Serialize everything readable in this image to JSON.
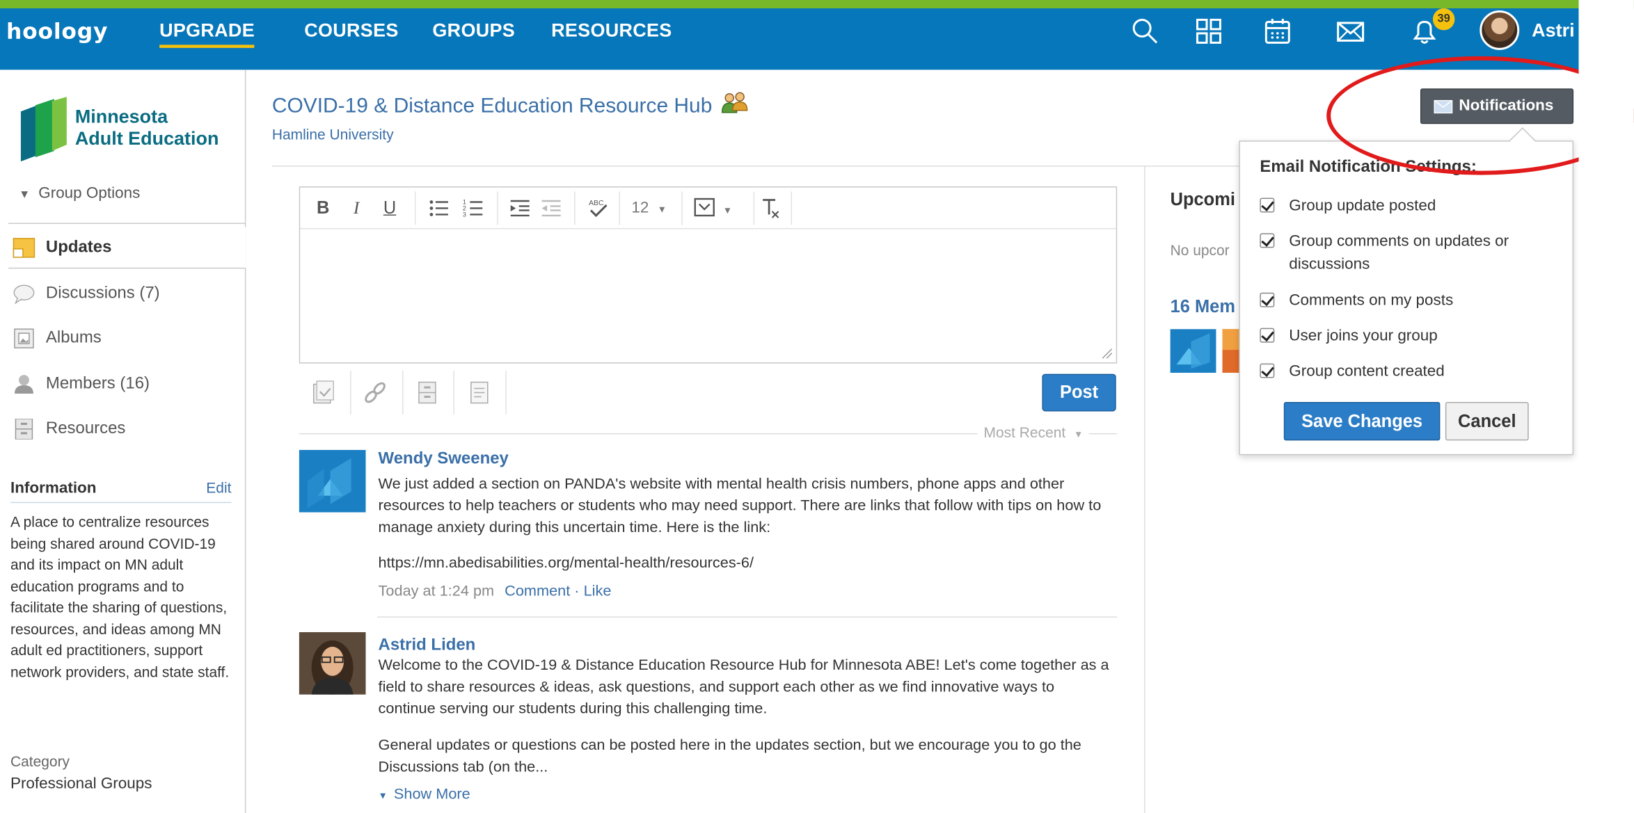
{
  "nav": {
    "logo": "hoology",
    "links": [
      "UPGRADE",
      "COURSES",
      "GROUPS",
      "RESOURCES"
    ],
    "notification_count": "39",
    "user_name": "Astri"
  },
  "sidebar": {
    "org_name_line1": "Minnesota",
    "org_name_line2": "Adult Education",
    "group_options": "Group Options",
    "items": [
      {
        "label": "Updates"
      },
      {
        "label": "Discussions (7)"
      },
      {
        "label": "Albums"
      },
      {
        "label": "Members (16)"
      },
      {
        "label": "Resources"
      }
    ],
    "info_heading": "Information",
    "info_edit": "Edit",
    "info_text": "A place to centralize resources being shared around COVID-19 and its impact on MN adult education programs and to facilitate the sharing of questions, resources, and ideas among MN adult ed practitioners, support network providers, and state staff.",
    "category_label": "Category",
    "category_value": "Professional Groups"
  },
  "main": {
    "title": "COVID-19 & Distance Education Resource Hub",
    "subtitle": "Hamline University",
    "toolbar": {
      "bold": "B",
      "italic": "I",
      "underline": "U",
      "font_size": "12"
    },
    "post_button": "Post",
    "sort_label": "Most Recent",
    "posts": [
      {
        "author": "Wendy Sweeney",
        "text": "We just added a section on PANDA's website with mental health crisis numbers, phone apps and other resources to help teachers or students who may need support.  There are links that follow with tips on how to manage anxiety during this uncertain time.  Here is the link:",
        "link": "https://mn.abedisabilities.org/mental-health/resources-6/",
        "time": "Today at 1:24 pm",
        "actions": "Comment · Like"
      },
      {
        "author": "Astrid Liden",
        "text": "Welcome to the COVID-19 & Distance Education Resource Hub for Minnesota ABE!  Let's come together as a field to share resources & ideas, ask questions, and support each other as we find innovative ways to continue serving our students during this challenging time.",
        "text2": "General updates or questions can be posted here in the updates section, but we encourage you to go the Discussions tab (on the...",
        "show_more": "Show More"
      }
    ]
  },
  "right": {
    "upcoming": "Upcomi",
    "no_upcoming": "No upcor",
    "members": "16 Mem"
  },
  "notifications": {
    "button_label": "Notifications",
    "heading": "Email Notification Settings:",
    "options": [
      {
        "label": "Group update posted",
        "checked": true
      },
      {
        "label": "Group comments on updates or discussions",
        "checked": true
      },
      {
        "label": "Comments on my posts",
        "checked": true
      },
      {
        "label": "User joins your group",
        "checked": true
      },
      {
        "label": "Group content created",
        "checked": true
      }
    ],
    "save": "Save Changes",
    "cancel": "Cancel"
  },
  "colors": {
    "nav": "#0677ba",
    "accent_green": "#76b82a",
    "link": "#3a6fa8",
    "button": "#2b7dc7",
    "annotation": "#e11b1b"
  }
}
